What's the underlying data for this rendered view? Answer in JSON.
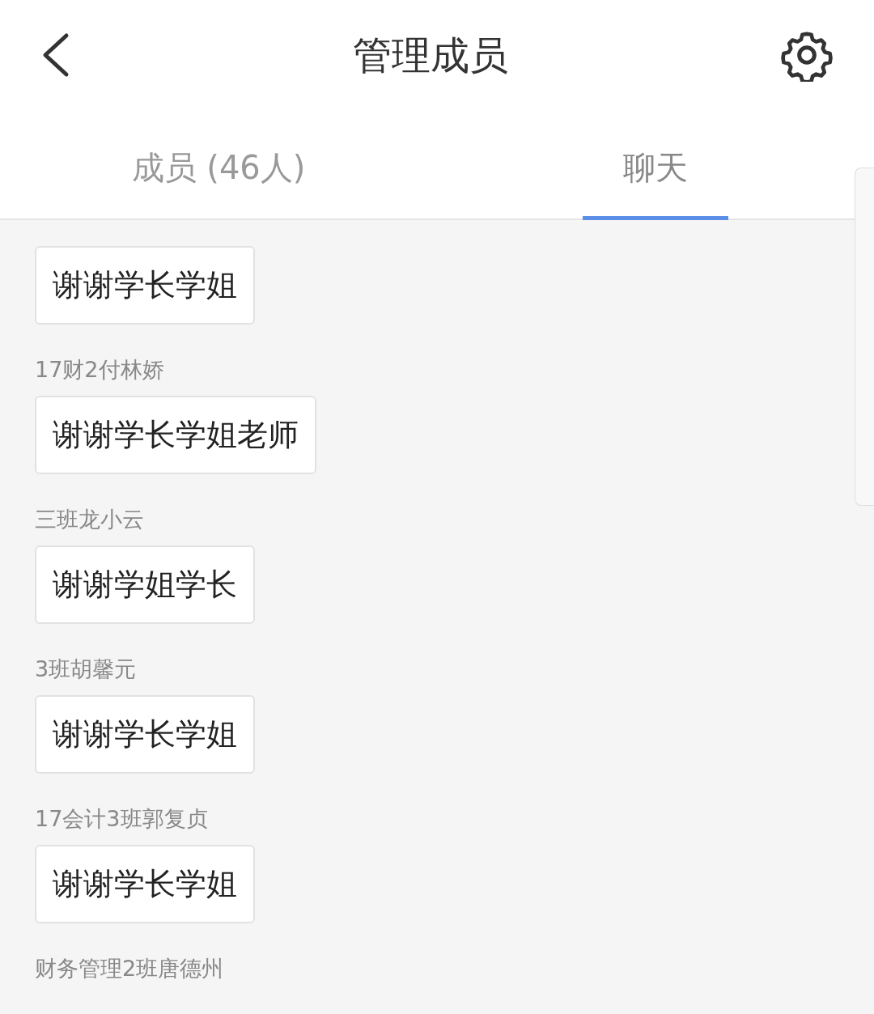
{
  "header": {
    "title": "管理成员"
  },
  "tabs": [
    {
      "label": "成员 (46人)",
      "selected": false
    },
    {
      "label": "聊天",
      "selected": true
    }
  ],
  "messages": [
    {
      "text": "谢谢学长学姐"
    },
    {
      "sender": "17财2付林娇",
      "text": "谢谢学长学姐老师"
    },
    {
      "sender": "三班龙小云",
      "text": "谢谢学姐学长"
    },
    {
      "sender": "3班胡馨元",
      "text": "谢谢学长学姐"
    },
    {
      "sender": "17会计3班郭复贞",
      "text": "谢谢学长学姐"
    },
    {
      "sender": "财务管理2班唐德州"
    }
  ]
}
